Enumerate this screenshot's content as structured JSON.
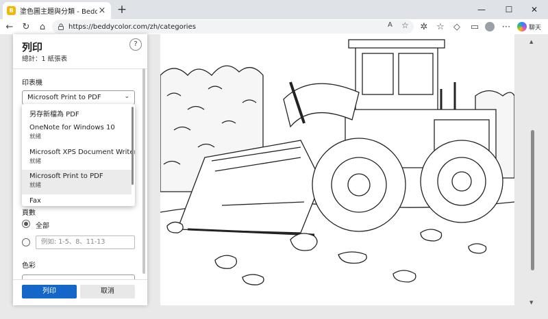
{
  "browser": {
    "tab_title": "塗色圖主題與分類 - BeddyColor",
    "favicon_letter": "B",
    "url": "https://beddycolor.com/zh/categories",
    "chat_label": "聊天"
  },
  "print_dialog": {
    "title": "列印",
    "subtitle": "總計：1 紙張表",
    "printer_label": "印表機",
    "printer_selected": "Microsoft Print to PDF",
    "printer_options": [
      {
        "name": "另存新檔為 PDF",
        "status": ""
      },
      {
        "name": "OneNote for Windows 10",
        "status": "就緒"
      },
      {
        "name": "Microsoft XPS Document Writer",
        "status": "就緒"
      },
      {
        "name": "Microsoft Print to PDF",
        "status": "就緒"
      },
      {
        "name": "Fax",
        "status": ""
      }
    ],
    "pages_label": "頁數",
    "pages_all": "全部",
    "pages_placeholder": "例如: 1-5、8、11-13",
    "color_label": "色彩",
    "print_button": "列印",
    "cancel_button": "取消"
  },
  "colors": {
    "accent": "#1267c9"
  }
}
